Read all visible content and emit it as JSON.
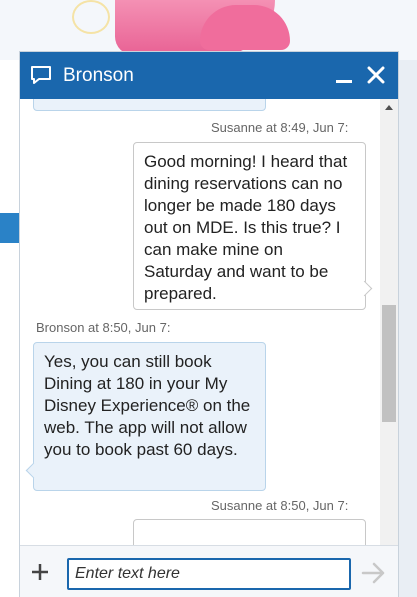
{
  "chat": {
    "agent_name": "Bronson",
    "input_placeholder": "Enter text here",
    "messages": [
      {
        "sender": "Susanne",
        "time": "Susanne at 8:49, Jun 7:",
        "text": "Good morning! I heard that dining reservations can no longer be made 180 days out on MDE. Is this true? I can make mine on Saturday and want to be prepared."
      },
      {
        "sender": "Bronson",
        "time": "Bronson at 8:50, Jun 7:",
        "text": "Yes, you can still book Dining at 180 in your My Disney Experience® on the web. The app will not allow you to book past 60 days."
      },
      {
        "sender": "Susanne",
        "time": "Susanne at 8:50, Jun 7:",
        "text": ""
      }
    ]
  },
  "colors": {
    "header": "#1a67ad",
    "agent_bubble": "#eaf2fa",
    "user_bubble": "#ffffff"
  },
  "icons": {
    "chat": "chat-bubble-icon",
    "minimize": "minimize-icon",
    "close": "close-icon",
    "attach": "plus-icon",
    "send": "arrow-right-icon"
  }
}
